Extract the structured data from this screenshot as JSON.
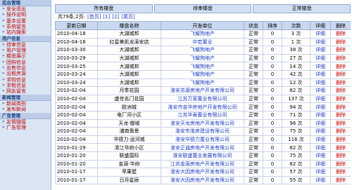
{
  "sidebar": {
    "sections": [
      {
        "title": "后台管理",
        "items": [
          "安全退出",
          "操作说明",
          "基本设置",
          "系统留言",
          "站内搜索"
        ]
      },
      {
        "title": "用户信息",
        "items": [
          "待审信息",
          "用户管理",
          "楼盘展示",
          "团购信息",
          "出售信息",
          "出租房源",
          "求购信息",
          "求租信息",
          "网友留言"
        ]
      },
      {
        "title": "新闻管理",
        "items": [
          "新闻类别",
          "发布新闻"
        ]
      },
      {
        "title": "广告管理",
        "items": [
          "友情链接",
          "广告管理"
        ]
      }
    ]
  },
  "tabs": [
    "所有楼盘",
    "待审楼盘",
    "正常楼盘"
  ],
  "pager": {
    "text": "共79条,2页:",
    "links": [
      "[首页]",
      "[1]",
      "[2]",
      "[尾页]"
    ]
  },
  "table": {
    "headers": [
      "更新日期",
      "楼盘名称",
      "开发单位",
      "状态",
      "排序",
      "次数",
      "详细",
      "删除"
    ],
    "rows": [
      {
        "date": "2010-04-18",
        "name": "大湖城邦",
        "dev": "飞耀狗地产",
        "status": "正常",
        "order": "0",
        "count": "3 次",
        "detail": "详细",
        "del": "删除"
      },
      {
        "date": "2010-04-16",
        "name": "红星美凯龙凑安店",
        "dev": "中宏置业",
        "status": "正常",
        "order": "0",
        "count": "1 次",
        "detail": "详细",
        "del": "删除"
      },
      {
        "date": "2010-03-30",
        "name": "大湖城邦",
        "dev": "飞耀狗地产",
        "status": "正常",
        "order": "0",
        "count": "38 次",
        "detail": "详细",
        "del": "删除"
      },
      {
        "date": "2010-03-29",
        "name": "大湖城邦",
        "dev": "飞耀狗地产",
        "status": "正常",
        "order": "0",
        "count": "27 次",
        "detail": "详细",
        "del": "删除"
      },
      {
        "date": "2010-03-25",
        "name": "大湖城邦",
        "dev": "飞耀狗地产",
        "status": "正常",
        "order": "0",
        "count": "14 次",
        "detail": "详细",
        "del": "删除"
      },
      {
        "date": "2010-03-24",
        "name": "大湖城邦",
        "dev": "飞耀狗地产",
        "status": "正常",
        "order": "0",
        "count": "42 次",
        "detail": "详细",
        "del": "删除"
      },
      {
        "date": "2010-03-24",
        "name": "大湖城邦",
        "dev": "飞耀狗地产",
        "status": "正常",
        "order": "0",
        "count": "12 次",
        "detail": "详细",
        "del": "删除"
      },
      {
        "date": "2010-02-04",
        "name": "月季花园",
        "dev": "淮安苏源房地产开发有限公司",
        "status": "正常",
        "order": "0",
        "count": "82 次",
        "detail": "详细",
        "del": "删除"
      },
      {
        "date": "2010-02-04",
        "name": "盛世名门花园",
        "dev": "江苏万家置业有限公司",
        "status": "正常",
        "order": "0",
        "count": "137 次",
        "detail": "详细",
        "del": "删除"
      },
      {
        "date": "2010-02-04",
        "name": "欧洲城",
        "dev": "淮安市金华房地产开发有限公司",
        "status": "正常",
        "order": "0",
        "count": "94 次",
        "detail": "详细",
        "del": "删除"
      },
      {
        "date": "2010-02-04",
        "name": "电厂河小区",
        "dev": "江苏华泰置业有限公司",
        "status": "正常",
        "order": "0",
        "count": "71 次",
        "detail": "详细",
        "del": "删除"
      },
      {
        "date": "2010-02-04",
        "name": "天龙·御墟",
        "dev": "淮安天龙房地产开发有限公司",
        "status": "正常",
        "order": "0",
        "count": "96 次",
        "detail": "详细",
        "del": "删除"
      },
      {
        "date": "2010-02-04",
        "name": "浦南翡景",
        "dev": "淮安市淮房建设有限公司",
        "status": "正常",
        "order": "0",
        "count": "75 次",
        "detail": "详细",
        "del": "删除"
      },
      {
        "date": "2010-02-04",
        "name": "华德力·运河城",
        "dev": "淮安华德力置业有限公司",
        "status": "正常",
        "order": "0",
        "count": "116 次",
        "detail": "详细",
        "del": "删除"
      },
      {
        "date": "2010-01-29",
        "name": "清江华府小区",
        "dev": "淮安正诚房地产开发有限公司",
        "status": "正常",
        "order": "0",
        "count": "82 次",
        "detail": "详细",
        "del": "删除"
      },
      {
        "date": "2010-01-20",
        "name": "联盛国际",
        "dev": "淮安联盛置业发展有限公司",
        "status": "正常",
        "order": "0",
        "count": "75 次",
        "detail": "详细",
        "del": "删除"
      },
      {
        "date": "2010-01-20",
        "name": "金源·华府",
        "dev": "江苏金源房地产开发有限公司",
        "status": "正常",
        "order": "0",
        "count": "82 次",
        "detail": "详细",
        "del": "删除"
      },
      {
        "date": "2010-01-17",
        "name": "苹果墅",
        "dev": "淮安大因房地产开发有限公司",
        "status": "正常",
        "order": "0",
        "count": "57 次",
        "detail": "详细",
        "del": "删除"
      },
      {
        "date": "2010-01-17",
        "name": "日月星辰",
        "dev": "淮安大因房地产开发有限公司",
        "status": "正常",
        "order": "0",
        "count": "55 次",
        "detail": "详细",
        "del": "删除"
      }
    ]
  }
}
